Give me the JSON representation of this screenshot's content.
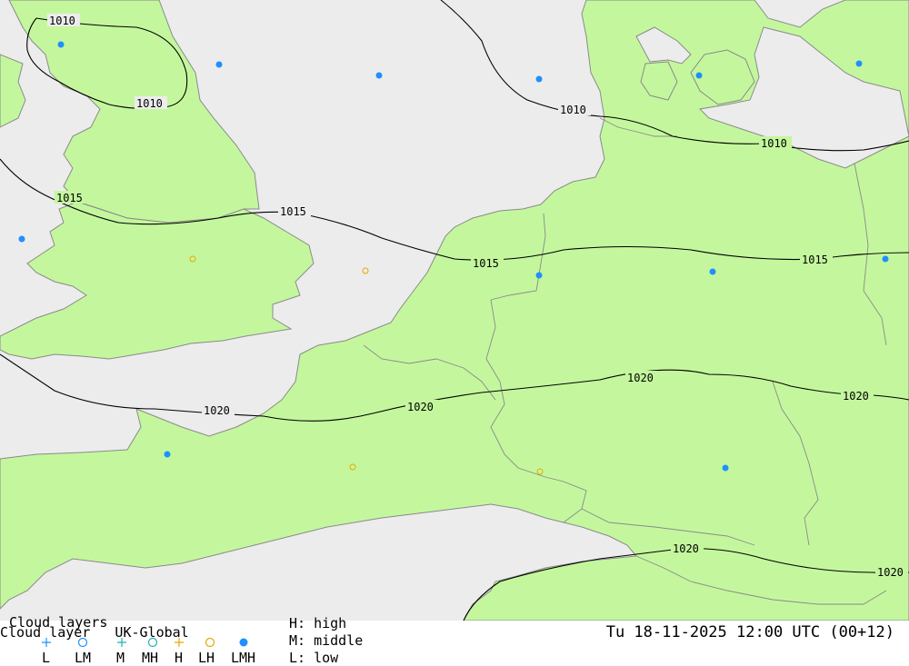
{
  "map": {
    "isobar_labels": [
      "1010",
      "1010",
      "1010",
      "1010",
      "1015",
      "1015",
      "1015",
      "1015",
      "1020",
      "1020",
      "1020",
      "1020",
      "1020",
      "1020"
    ],
    "colors": {
      "sea": "#ececec",
      "land": "#c4f79d",
      "coast": "#8a8a8a",
      "isobar": "#000000",
      "lmh_marker": "#1e90ff",
      "lh_marker": "#e8a800"
    }
  },
  "legend": {
    "title": "Cloud layers",
    "subtitle": "Cloud layer   UK-Global",
    "symbol_labels": [
      "L",
      "LM",
      "M",
      "MH",
      "H",
      "LH",
      "LMH"
    ],
    "high_key": "H: high",
    "middle_key": "M: middle",
    "low_key": "L: low",
    "datetime": "Tu 18-11-2025 12:00 UTC (00+12)"
  }
}
